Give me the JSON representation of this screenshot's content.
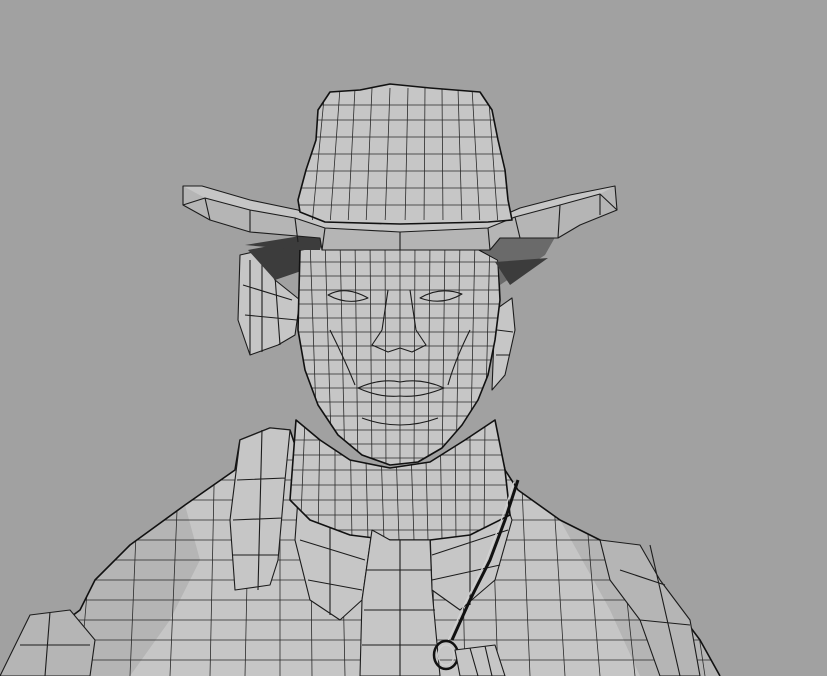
{
  "viewport": {
    "background_color": "#a1a1a1",
    "mesh_color": "#c4c4c4",
    "wireframe_color": "#1c1c1c",
    "display_mode": "wireframe-on-shaded"
  },
  "model": {
    "parts": [
      "cowboy-hat",
      "head",
      "face",
      "ear",
      "neck",
      "jacket",
      "collar",
      "shoulder-strap",
      "ring"
    ]
  }
}
